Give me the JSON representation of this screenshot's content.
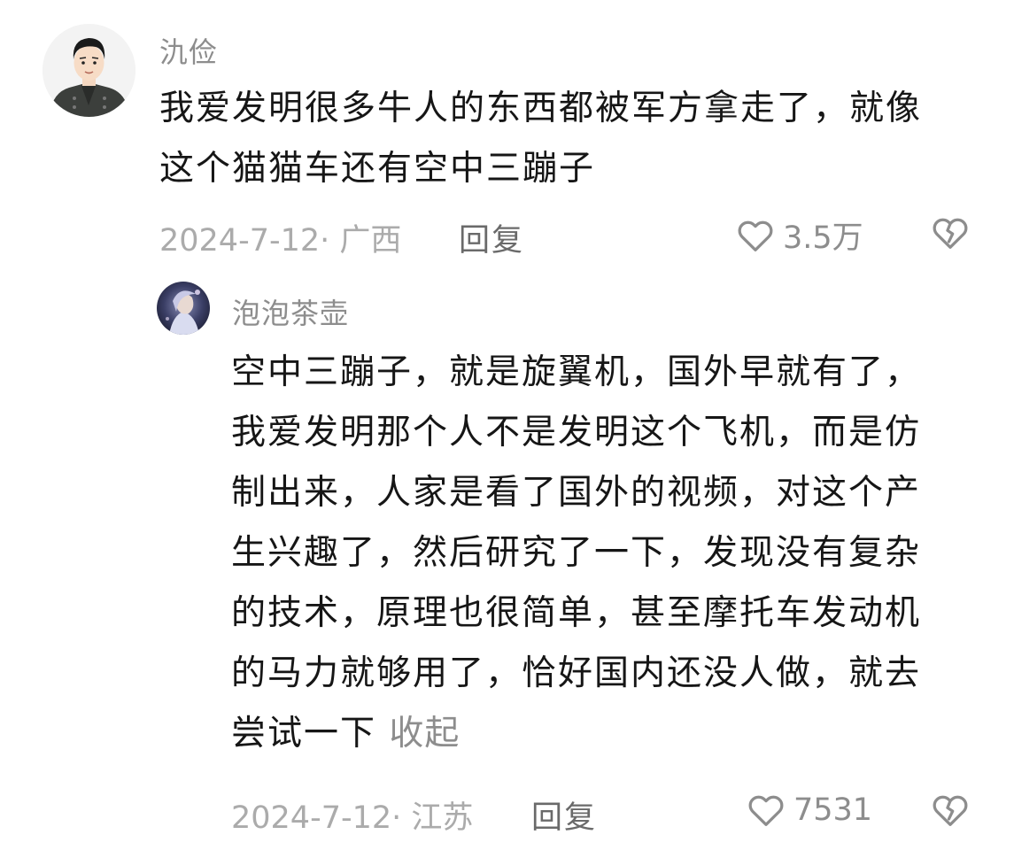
{
  "comments": [
    {
      "username": "氿俭",
      "avatar": "man-cartoon-avatar",
      "text_lines": [
        "我爱发明很多牛人的东西都被军方拿走了，就像",
        "这个猫猫车还有空中三蹦子"
      ],
      "date_location": "2024-7-12· 广西",
      "reply_label": "回复",
      "like_icon": "heart-outline-icon",
      "like_count": "3.5万",
      "dislike_icon": "broken-heart-icon"
    },
    {
      "username": "泡泡茶壶",
      "avatar": "anime-character-avatar",
      "text_lines": [
        "空中三蹦子，就是旋翼机，国外早就有了，",
        "我爱发明那个人不是发明这个飞机，而是仿",
        "制出来，人家是看了国外的视频，对这个产",
        "生兴趣了，然后研究了一下，发现没有复杂",
        "的技术，原理也很简单，甚至摩托车发动机",
        "的马力就够用了，恰好国内还没人做，就去",
        "尝试一下"
      ],
      "collapse_label": "收起",
      "date_location": "2024-7-12· 江苏",
      "reply_label": "回复",
      "like_icon": "heart-outline-icon",
      "like_count": "7531",
      "dislike_icon": "broken-heart-icon"
    }
  ],
  "colors": {
    "text_primary": "#161616",
    "text_secondary": "#8d8d8d",
    "text_meta": "#ababab",
    "reply": "#6a6a6a",
    "icon": "#8d8d8d"
  }
}
